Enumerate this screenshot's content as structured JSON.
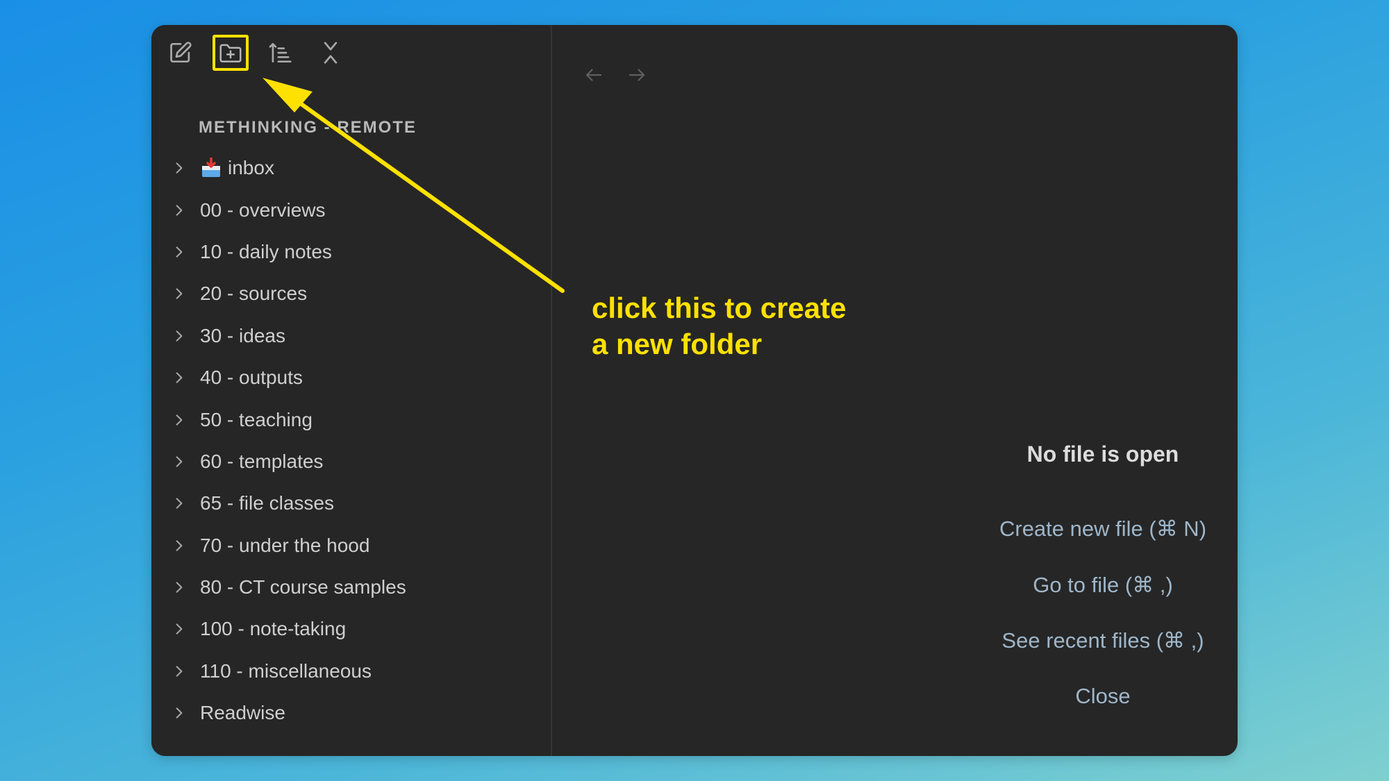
{
  "toolbar": {
    "buttons": [
      {
        "icon": "new-note-icon"
      },
      {
        "icon": "new-folder-icon"
      },
      {
        "icon": "sort-icon"
      },
      {
        "icon": "collapse-all-icon"
      }
    ]
  },
  "sidebar": {
    "vault_name": "METHINKING - REMOTE",
    "items": [
      {
        "label": "inbox",
        "icon": "inbox-tray-icon"
      },
      {
        "label": "00 - overviews"
      },
      {
        "label": "10 - daily notes"
      },
      {
        "label": "20 - sources"
      },
      {
        "label": "30 - ideas"
      },
      {
        "label": "40 - outputs"
      },
      {
        "label": "50 - teaching"
      },
      {
        "label": "60 - templates"
      },
      {
        "label": "65 - file classes"
      },
      {
        "label": "70 - under the hood"
      },
      {
        "label": "80 - CT course samples"
      },
      {
        "label": "100 - note-taking"
      },
      {
        "label": "110 - miscellaneous"
      },
      {
        "label": "Readwise"
      }
    ]
  },
  "main": {
    "empty_title": "No file is open",
    "actions": [
      "Create new file (⌘ N)",
      "Go to file (⌘ ,)",
      "See recent files (⌘ ,)",
      "Close"
    ]
  },
  "annotation": {
    "line1": "click this to create",
    "line2": "a new folder",
    "color": "#ffe100"
  },
  "colors": {
    "window_bg": "#262626",
    "text": "#cfcfcf",
    "link": "#9fb6c9",
    "highlight": "#ffe100"
  }
}
